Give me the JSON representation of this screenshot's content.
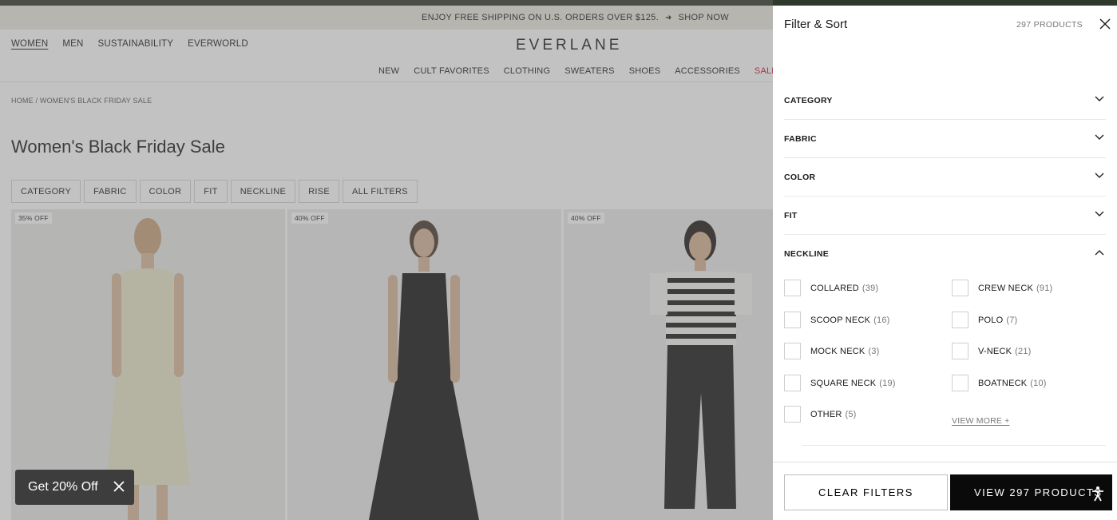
{
  "promo": {
    "text": "ENJOY FREE SHIPPING ON U.S. ORDERS OVER $125.",
    "arrow": "➜",
    "link": "SHOP NOW"
  },
  "nav": {
    "primary": [
      {
        "label": "WOMEN",
        "active": true
      },
      {
        "label": "MEN"
      },
      {
        "label": "SUSTAINABILITY"
      },
      {
        "label": "EVERWORLD"
      }
    ],
    "logo": "EVERLANE",
    "secondary": [
      "NEW",
      "CULT FAVORITES",
      "CLOTHING",
      "SWEATERS",
      "SHOES",
      "ACCESSORIES",
      "SALE"
    ]
  },
  "breadcrumb": "HOME / WOMEN'S BLACK FRIDAY SALE",
  "page_title": "Women's Black Friday Sale",
  "chips": [
    "CATEGORY",
    "FABRIC",
    "COLOR",
    "FIT",
    "NECKLINE",
    "RISE",
    "ALL FILTERS"
  ],
  "products": [
    {
      "badge": "35% OFF"
    },
    {
      "badge": "40% OFF"
    },
    {
      "badge": "40% OFF"
    }
  ],
  "toast": {
    "text": "Get 20% Off"
  },
  "drawer": {
    "title": "Filter & Sort",
    "count": "297 PRODUCTS",
    "sections": [
      "CATEGORY",
      "FABRIC",
      "COLOR",
      "FIT",
      "NECKLINE"
    ],
    "neckline_options": [
      {
        "label": "COLLARED",
        "count": "(39)"
      },
      {
        "label": "CREW NECK",
        "count": "(91)"
      },
      {
        "label": "SCOOP NECK",
        "count": "(16)"
      },
      {
        "label": "POLO",
        "count": "(7)"
      },
      {
        "label": "MOCK NECK",
        "count": "(3)"
      },
      {
        "label": "V-NECK",
        "count": "(21)"
      },
      {
        "label": "SQUARE NECK",
        "count": "(19)"
      },
      {
        "label": "BOATNECK",
        "count": "(10)"
      },
      {
        "label": "OTHER",
        "count": "(5)"
      }
    ],
    "view_more": "VIEW MORE +",
    "clear_label": "CLEAR FILTERS",
    "view_label": "VIEW 297 PRODUCTS"
  },
  "colors": {
    "sale": "#c8102e",
    "promo_bg": "#ebe8df",
    "primary_button": "#0a0a0a"
  },
  "icons": {
    "close": "close-icon",
    "chevron": "chevron-icon",
    "accessibility": "accessibility-icon"
  }
}
